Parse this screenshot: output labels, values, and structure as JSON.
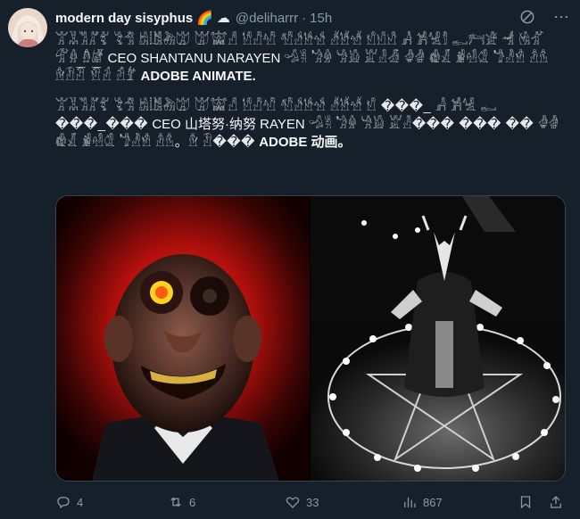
{
  "tweet": {
    "display_name": "modern day sisyphus",
    "emoji_1": "🌈",
    "emoji_2": "☁",
    "handle": "@deliharrr",
    "separator": "·",
    "time": "15h",
    "paragraph_1": {
      "glyphs_a": "𓀠𓀡𓀢𓀣𓀤 𓀥𓀦 𓀧𓀨𓀩𓀪 𓀫𓀬𓀭 𓀮𓀯𓀰 𓀱𓀲𓀳𓀴 𓀵𓀶𓀷 𓀸𓀹𓀺 𓀻 𓀼𓀽𓀾 𓀿𓁀𓁁 𓁂 𓁃𓁄 𓁅𓁆 𓁇𓁈",
      "name_text": "CEO SHANTANU NARAYEN",
      "glyphs_b": "𓁉𓁊 𓁋𓁌 𓁍𓁎 𓁏𓁐𓁑 𓁒𓁓 𓁔𓁕 𓁖𓁗𓁘 𓁙𓁚𓁛 𓁜𓁝 𓁞𓁟𓁠 𓁡𓁢 𓁣𓁤",
      "bold_text": "ADOBE ANIMATE."
    },
    "paragraph_2": {
      "glyphs_a": "𓀠𓀡𓀢𓀣𓀤 𓀥𓀦 𓀧𓀨𓀩𓀪 𓀫𓀬𓀭 𓀮𓀯𓀰 𓀱𓀲𓀳𓀴 𓀵𓀶𓀷 𓀸 ���_ 𓀻 𓀼𓀽 𓀿 ���_���",
      "name_text": "CEO 山塔努·纳努 RAYEN",
      "glyphs_b": "𓁉𓁊 𓁋𓁌 𓁍𓁎 𓁏𓁐���  ��� �� 𓁒𓁓 𓁔𓁕 𓁖𓁗𓁘 𓁙𓁚𓁛 𓁜𓁝。𓁞 𓁟���",
      "bold_text": "ADOBE 动画。"
    },
    "actions": {
      "replies": "4",
      "retweets": "6",
      "likes": "33",
      "views": "867"
    }
  }
}
